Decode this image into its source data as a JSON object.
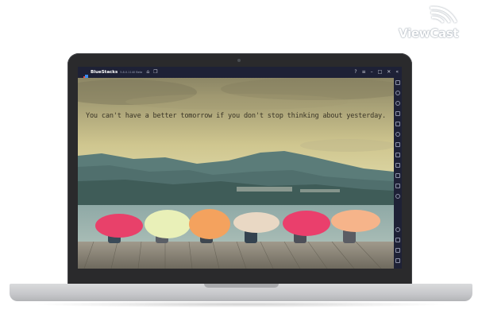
{
  "watermark": {
    "text": "ViewCast"
  },
  "emulator": {
    "app_name": "BlueStacks",
    "version": "5.8.0.1140 Beta",
    "titlebar_icons": [
      "home-icon",
      "multi-instance-icon"
    ],
    "window_controls": [
      "help-icon",
      "menu-icon",
      "minimize-icon",
      "maximize-icon",
      "close-icon",
      "collapse-sidebar-icon"
    ],
    "sidebar_icons": [
      "fullscreen-icon",
      "volume-up-icon",
      "volume-down-icon",
      "screen-record-icon",
      "keyboard-icon",
      "rotate-icon",
      "shake-icon",
      "screenshot-icon",
      "macro-icon",
      "folder-icon",
      "copy-icon",
      "eco-mode-icon",
      "settings-icon",
      "back-icon",
      "home-nav-icon",
      "recent-apps-icon"
    ]
  },
  "wallpaper": {
    "quote": "You can't have a better tomorrow if you don't stop thinking about yesterday.",
    "umbrella_colors": [
      "#e8416a",
      "#e9f0b8",
      "#f4a25e",
      "#e9d8c4",
      "#ea3f6c",
      "#f6b48a"
    ]
  }
}
